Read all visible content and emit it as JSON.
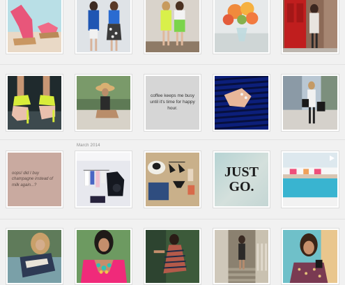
{
  "month_header": "March 2014",
  "tiles": [
    {
      "label": "pink-strappy-wedge-sandals-photo"
    },
    {
      "label": "women-blue-dress-and-floral-skirt-photo"
    },
    {
      "label": "women-neon-outfits-photo"
    },
    {
      "label": "orange-roses-in-vase-photo"
    },
    {
      "label": "woman-at-red-door-photo"
    },
    {
      "label": "lime-heels-on-carpet-photo"
    },
    {
      "label": "woman-in-sun-hat-photo"
    },
    {
      "label": "quote-card",
      "text": "coffee keeps me busy until it's time for happy hour."
    },
    {
      "label": "blue-striped-dress-rings-photo"
    },
    {
      "label": "woman-with-shopping-bags-photo"
    },
    {
      "label": "quote-card",
      "text": "oops! did I buy champagne instead of milk again...?"
    },
    {
      "label": "clothing-rack-studio-photo"
    },
    {
      "label": "bikini-flatlay-photo"
    },
    {
      "label": "just-go-text-image",
      "text": "JUST GO."
    },
    {
      "label": "pool-video-thumbnail"
    },
    {
      "label": "woman-blonde-hair-photo"
    },
    {
      "label": "pink-top-statement-necklace-photo"
    },
    {
      "label": "patterned-dress-pose-photo"
    },
    {
      "label": "woman-on-stairs-photo"
    },
    {
      "label": "woman-in-doorway-photo"
    }
  ]
}
